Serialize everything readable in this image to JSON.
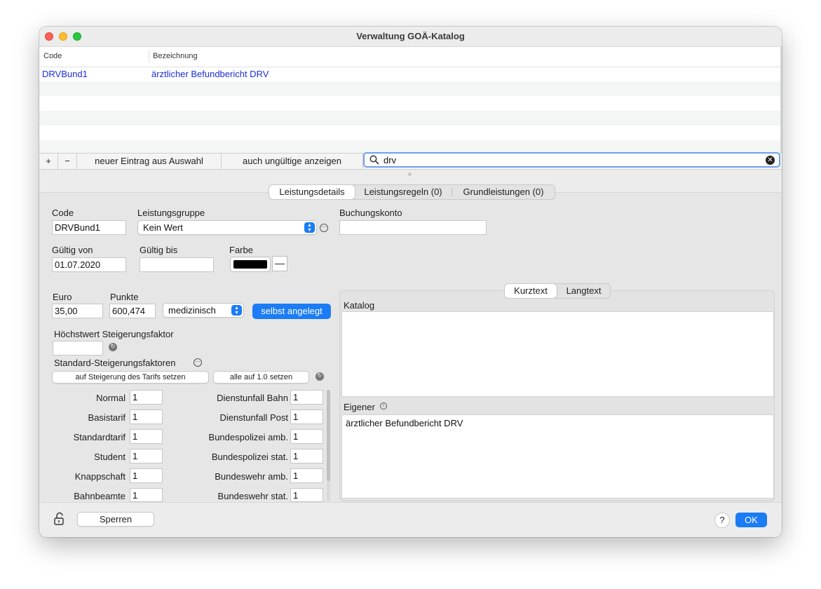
{
  "window": {
    "title": "Verwaltung GOÄ-Katalog"
  },
  "table": {
    "columns": [
      "Code",
      "Bezeichnung"
    ],
    "rows": [
      {
        "code": "DRVBund1",
        "bezeichnung": "ärztlicher Befundbericht DRV"
      }
    ]
  },
  "list_toolbar": {
    "add": "+",
    "remove": "−",
    "new_from_selection": "neuer Eintrag aus Auswahl",
    "show_invalid": "auch ungültige anzeigen",
    "search_value": "drv"
  },
  "tabs": {
    "items": [
      "Leistungsdetails",
      "Leistungsregeln (0)",
      "Grundleistungen (0)"
    ],
    "selected": "Leistungsdetails"
  },
  "form": {
    "code_label": "Code",
    "code_value": "DRVBund1",
    "group_label": "Leistungsgruppe",
    "group_value": "Kein Wert",
    "account_label": "Buchungskonto",
    "account_value": "",
    "valid_from_label": "Gültig von",
    "valid_from_value": "01.07.2020",
    "valid_to_label": "Gültig bis",
    "valid_to_value": "",
    "color_label": "Farbe",
    "color_value": "#000000",
    "color_minus": "—",
    "euro_label": "Euro",
    "euro_value": "35,00",
    "points_label": "Punkte",
    "points_value": "600,474",
    "type_value": "medizinisch",
    "self_created": "selbst angelegt",
    "max_factor_label": "Höchstwert Steigerungsfaktor",
    "max_factor_value": "",
    "std_factors_label": "Standard-Steigerungsfaktoren",
    "set_tariff_button": "auf Steigerung des Tarifs setzen",
    "set_all_button": "alle auf 1.0 setzen"
  },
  "factors_left": [
    {
      "label": "Normal",
      "value": "1"
    },
    {
      "label": "Basistarif",
      "value": "1"
    },
    {
      "label": "Standardtarif",
      "value": "1"
    },
    {
      "label": "Student",
      "value": "1"
    },
    {
      "label": "Knappschaft",
      "value": "1"
    },
    {
      "label": "Bahnbeamte",
      "value": "1"
    }
  ],
  "factors_right": [
    {
      "label": "Dienstunfall Bahn",
      "value": "1"
    },
    {
      "label": "Dienstunfall Post",
      "value": "1"
    },
    {
      "label": "Bundespolizei amb.",
      "value": "1"
    },
    {
      "label": "Bundespolizei stat.",
      "value": "1"
    },
    {
      "label": "Bundeswehr amb.",
      "value": "1"
    },
    {
      "label": "Bundeswehr stat.",
      "value": "1"
    }
  ],
  "text_tabs": {
    "items": [
      "Kurztext",
      "Langtext"
    ],
    "selected": "Kurztext"
  },
  "katalog": {
    "label": "Katalog",
    "value": ""
  },
  "eigener": {
    "label": "Eigener",
    "value": "ärztlicher Befundbericht DRV"
  },
  "footer": {
    "lock_button": "Sperren",
    "help": "?",
    "ok": "OK"
  },
  "colors": {
    "accent": "#1b7cf5",
    "link_text": "#1a2fd6",
    "search_focus": "#6ea2e8"
  }
}
